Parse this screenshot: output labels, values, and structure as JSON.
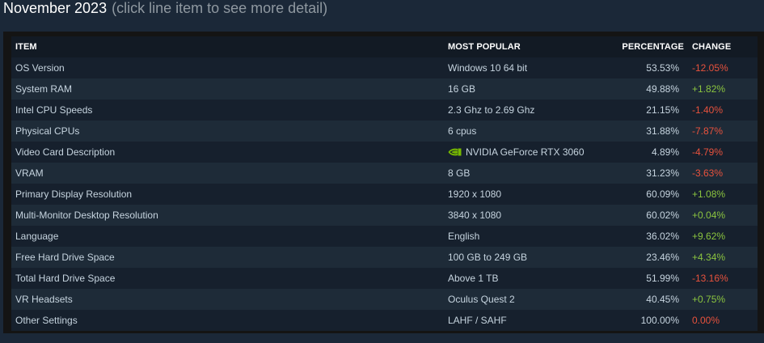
{
  "header": {
    "month": "November 2023",
    "hint": "(click line item to see more detail)"
  },
  "table": {
    "columns": {
      "item": "ITEM",
      "most_popular": "MOST POPULAR",
      "percentage": "PERCENTAGE",
      "change": "CHANGE"
    },
    "rows": [
      {
        "item": "OS Version",
        "most_popular": "Windows 10 64 bit",
        "percentage": "53.53%",
        "change": "-12.05%",
        "trend": "negative"
      },
      {
        "item": "System RAM",
        "most_popular": "16 GB",
        "percentage": "49.88%",
        "change": "+1.82%",
        "trend": "positive"
      },
      {
        "item": "Intel CPU Speeds",
        "most_popular": "2.3 Ghz to 2.69 Ghz",
        "percentage": "21.15%",
        "change": "-1.40%",
        "trend": "negative"
      },
      {
        "item": "Physical CPUs",
        "most_popular": "6 cpus",
        "percentage": "31.88%",
        "change": "-7.87%",
        "trend": "negative"
      },
      {
        "item": "Video Card Description",
        "most_popular": "NVIDIA GeForce RTX 3060",
        "percentage": "4.89%",
        "change": "-4.79%",
        "trend": "negative",
        "icon": "nvidia-logo-icon"
      },
      {
        "item": "VRAM",
        "most_popular": "8 GB",
        "percentage": "31.23%",
        "change": "-3.63%",
        "trend": "negative"
      },
      {
        "item": "Primary Display Resolution",
        "most_popular": "1920 x 1080",
        "percentage": "60.09%",
        "change": "+1.08%",
        "trend": "positive"
      },
      {
        "item": "Multi-Monitor Desktop Resolution",
        "most_popular": "3840 x 1080",
        "percentage": "60.02%",
        "change": "+0.04%",
        "trend": "positive"
      },
      {
        "item": "Language",
        "most_popular": "English",
        "percentage": "36.02%",
        "change": "+9.62%",
        "trend": "positive"
      },
      {
        "item": "Free Hard Drive Space",
        "most_popular": "100 GB to 249 GB",
        "percentage": "23.46%",
        "change": "+4.34%",
        "trend": "positive"
      },
      {
        "item": "Total Hard Drive Space",
        "most_popular": "Above 1 TB",
        "percentage": "51.99%",
        "change": "-13.16%",
        "trend": "negative"
      },
      {
        "item": "VR Headsets",
        "most_popular": "Oculus Quest 2",
        "percentage": "40.45%",
        "change": "+0.75%",
        "trend": "positive"
      },
      {
        "item": "Other Settings",
        "most_popular": "LAHF / SAHF",
        "percentage": "100.00%",
        "change": "0.00%",
        "trend": "zero"
      }
    ]
  },
  "colors": {
    "background": "#1b2838",
    "panel": "#141414",
    "row_odd": "#16202d",
    "row_even": "#1e2b38",
    "text": "#c6d4df",
    "hint": "#8f98a0",
    "negative": "#e8523d",
    "positive": "#8bc53f",
    "nvidia_green": "#76b900"
  }
}
